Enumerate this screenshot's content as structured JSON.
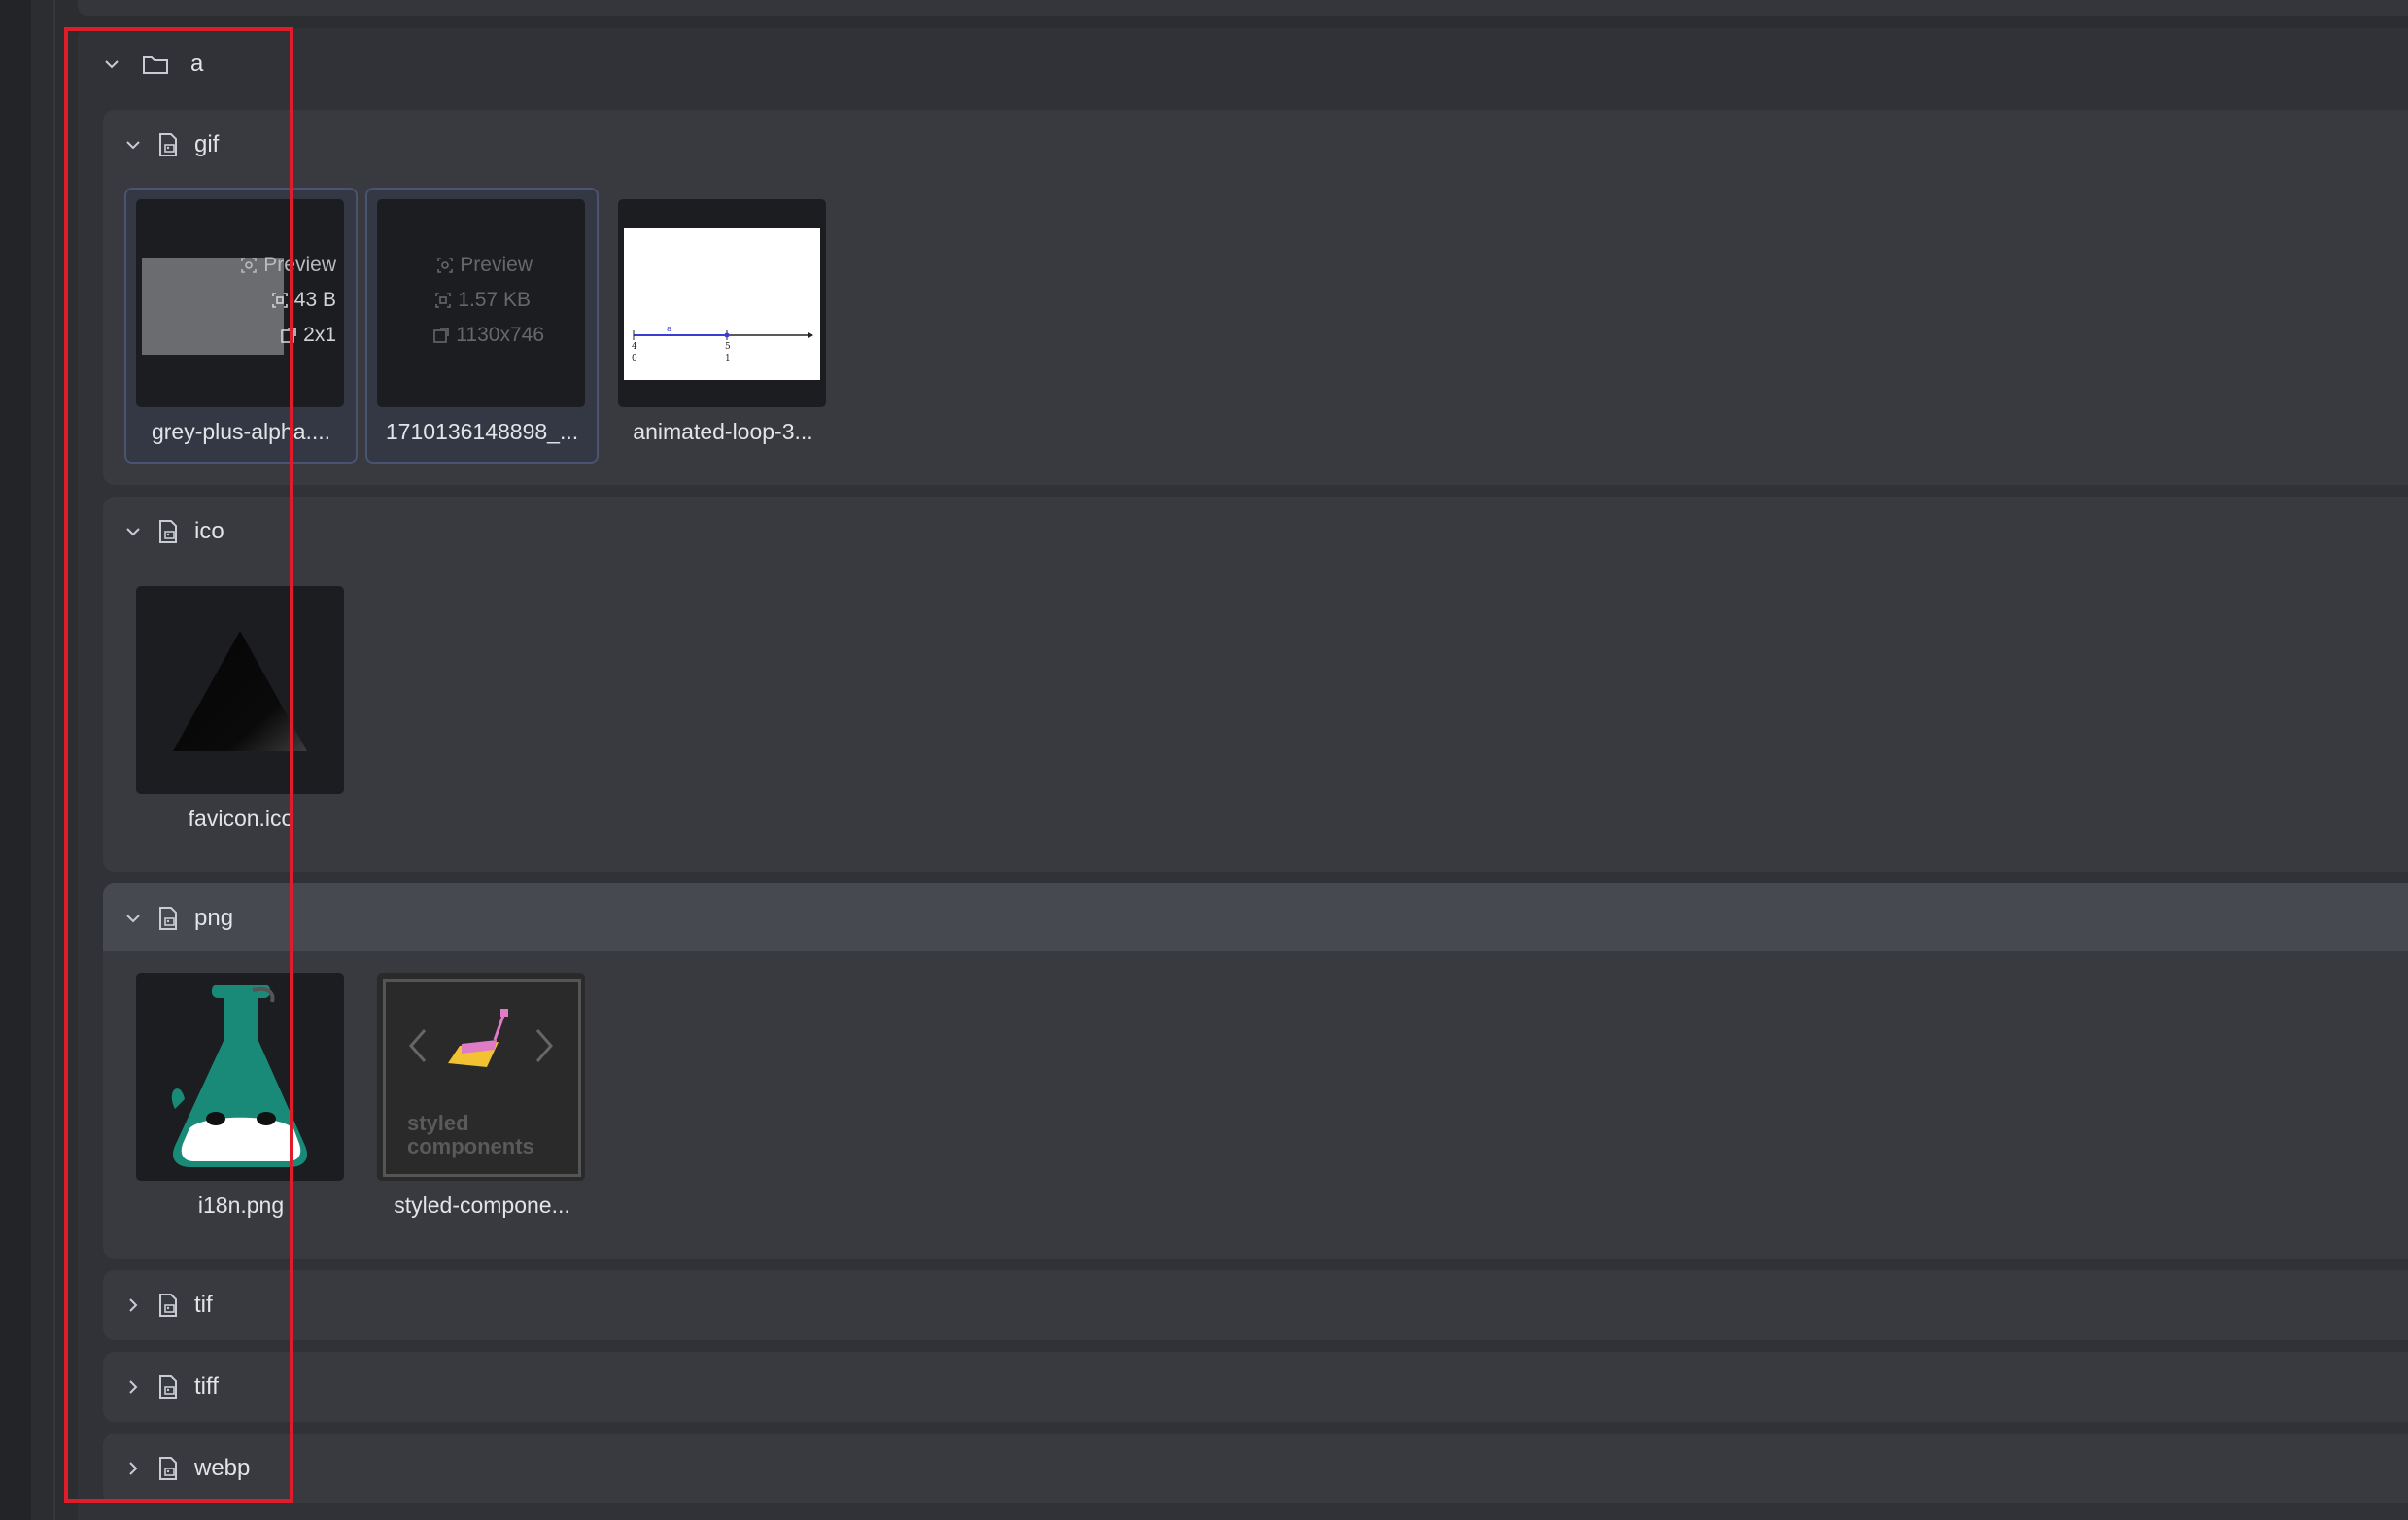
{
  "folder": {
    "name": "a",
    "icon": "folder-icon",
    "expanded": true
  },
  "groups": [
    {
      "label": "gif",
      "expanded": true,
      "files": [
        {
          "name": "grey-plus-alpha....",
          "preview_label": "Preview",
          "size": "43 B",
          "dimensions": "2x1",
          "selected": true
        },
        {
          "name": "1710136148898_...",
          "preview_label": "Preview",
          "size": "1.57 KB",
          "dimensions": "1130x746",
          "selected": true
        },
        {
          "name": "animated-loop-3...",
          "chart_labels": [
            "a",
            "4",
            "5",
            "0",
            "1"
          ]
        }
      ]
    },
    {
      "label": "ico",
      "expanded": true,
      "files": [
        {
          "name": "favicon.ico"
        }
      ]
    },
    {
      "label": "png",
      "expanded": true,
      "active": true,
      "files": [
        {
          "name": "i18n.png"
        },
        {
          "name": "styled-compone...",
          "logo_text_1": "styled",
          "logo_text_2": "components"
        }
      ]
    },
    {
      "label": "tif",
      "expanded": false
    },
    {
      "label": "tiff",
      "expanded": false
    },
    {
      "label": "webp",
      "expanded": false
    }
  ],
  "colors": {
    "accent_selection": "#4a5470",
    "highlight_box": "#e01b2a",
    "flask_teal": "#1a8a78"
  }
}
